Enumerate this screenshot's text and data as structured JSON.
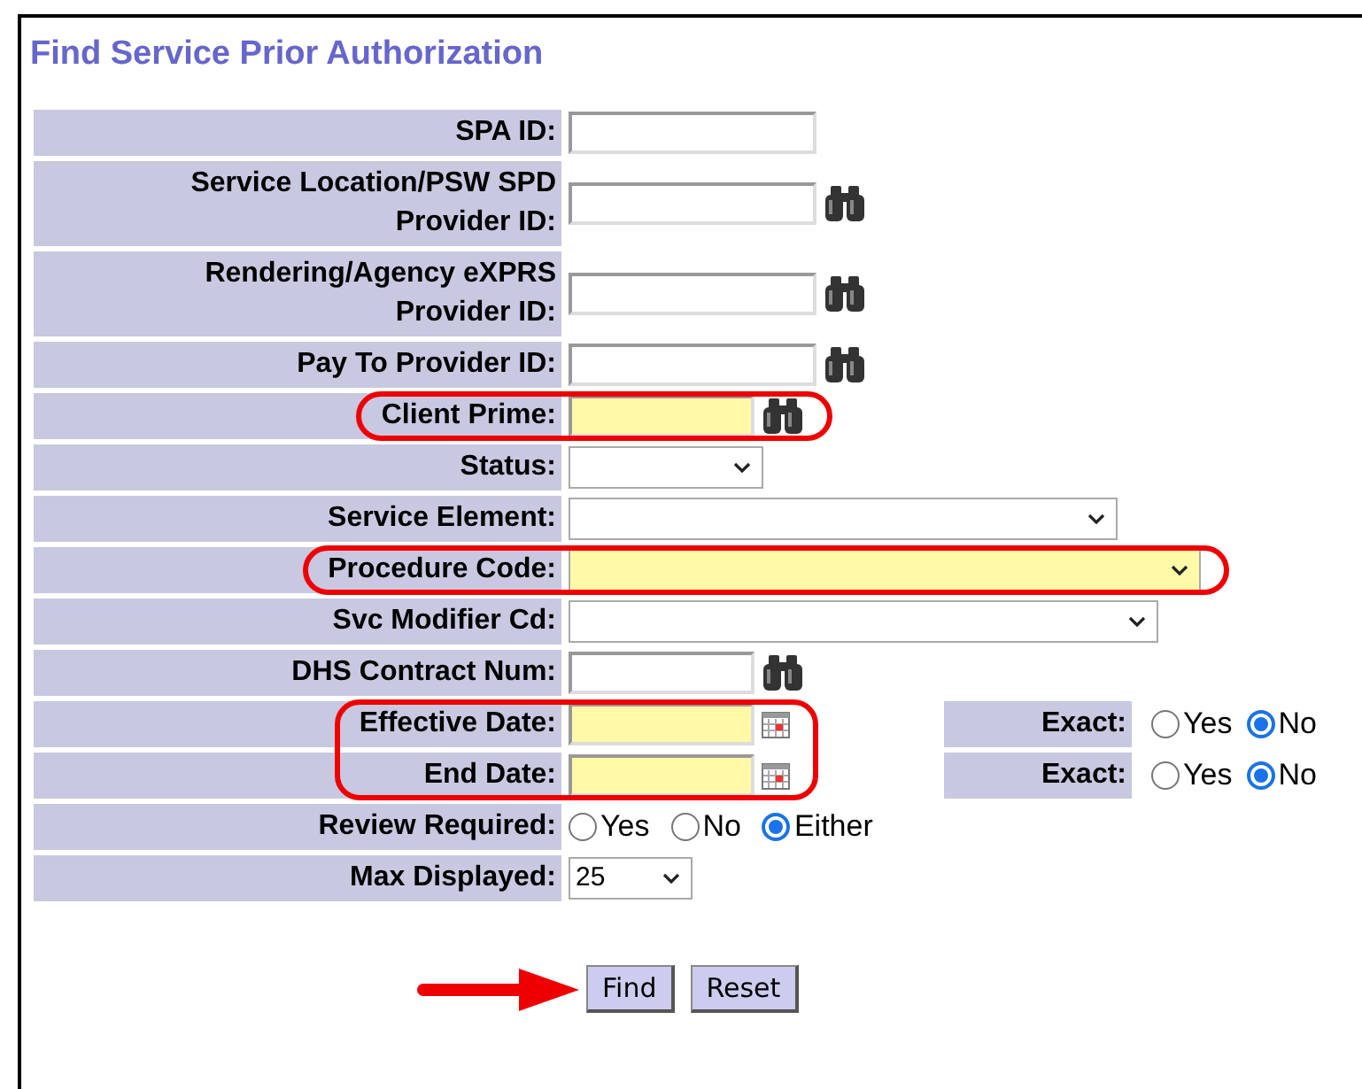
{
  "title": "Find Service Prior Authorization",
  "rows": [
    {
      "label": "SPA ID:",
      "kind": "text",
      "required": false
    },
    {
      "label": "Service Location/PSW SPD Provider ID:",
      "kind": "text",
      "required": false,
      "lookup": true
    },
    {
      "label": "Rendering/Agency eXPRS Provider ID:",
      "kind": "text",
      "required": false,
      "lookup": true
    },
    {
      "label": "Pay To Provider ID:",
      "kind": "text",
      "required": false,
      "lookup": true
    },
    {
      "label": "Client Prime:",
      "kind": "text",
      "required": true,
      "lookup": true,
      "highlight": true
    },
    {
      "label": "Status:",
      "kind": "select",
      "required": false
    },
    {
      "label": "Service Element:",
      "kind": "select",
      "required": false
    },
    {
      "label": "Procedure Code:",
      "kind": "select",
      "required": true,
      "highlight": true
    },
    {
      "label": "Svc Modifier Cd:",
      "kind": "select",
      "required": false
    },
    {
      "label": "DHS Contract Num:",
      "kind": "text",
      "required": false,
      "lookup": true
    },
    {
      "label": "Effective Date:",
      "kind": "date",
      "required": true,
      "highlight": true,
      "exact": {
        "label": "Exact:",
        "options": [
          {
            "label": "Yes",
            "selected": false
          },
          {
            "label": "No",
            "selected": true
          }
        ]
      }
    },
    {
      "label": "End Date:",
      "kind": "date",
      "required": true,
      "highlight": true,
      "exact": {
        "label": "Exact:",
        "options": [
          {
            "label": "Yes",
            "selected": false
          },
          {
            "label": "No",
            "selected": true
          }
        ]
      }
    },
    {
      "label": "Review Required:",
      "kind": "radio",
      "options": [
        {
          "label": "Yes",
          "selected": false
        },
        {
          "label": "No",
          "selected": false
        },
        {
          "label": "Either",
          "selected": true
        }
      ]
    },
    {
      "label": "Max Displayed:",
      "kind": "select",
      "value": "25",
      "required": false
    }
  ],
  "buttons": [
    {
      "label": "Find",
      "pointed": true
    },
    {
      "label": "Reset"
    }
  ]
}
